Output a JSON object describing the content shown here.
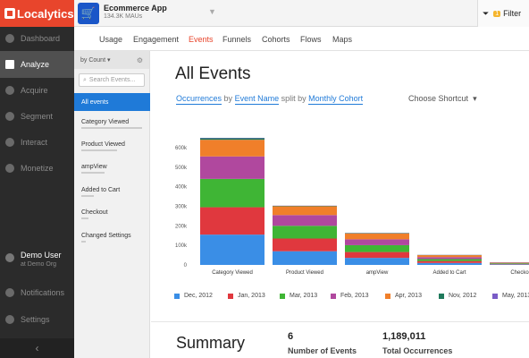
{
  "brand": {
    "name": "Localytics"
  },
  "nav": {
    "items": [
      {
        "label": "Dashboard",
        "icon": "dashboard-icon"
      },
      {
        "label": "Analyze",
        "icon": "analyze-icon",
        "active": true
      },
      {
        "label": "Acquire",
        "icon": "acquire-icon"
      },
      {
        "label": "Segment",
        "icon": "segment-icon"
      },
      {
        "label": "Interact",
        "icon": "interact-icon"
      },
      {
        "label": "Monetize",
        "icon": "monetize-icon"
      }
    ],
    "user": {
      "name": "Demo User",
      "org": "at Demo Org"
    },
    "notifications": "Notifications",
    "settings": "Settings",
    "collapse": "‹"
  },
  "topbar": {
    "app_name": "Ecommerce App",
    "app_maus": "134.3K MAUs",
    "filters_label": "Filter",
    "filters_count": "1"
  },
  "subnav": {
    "tabs": [
      "Usage",
      "Engagement",
      "Events",
      "Funnels",
      "Cohorts",
      "Flows",
      "Maps"
    ],
    "active": "Events"
  },
  "events_panel": {
    "sort_label": "by Count",
    "search_placeholder": "Search Events...",
    "items": [
      "All events",
      "Category Viewed",
      "Product Viewed",
      "ampView",
      "Added to Cart",
      "Checkout",
      "Changed Settings"
    ]
  },
  "main": {
    "title": "All Events",
    "controls": {
      "metric": "Occurrences",
      "by_word": "by",
      "dimension": "Event Name",
      "split_word": "split by",
      "split": "Monthly Cohort",
      "shortcut": "Choose Shortcut"
    },
    "summary": {
      "title": "Summary",
      "events_count": "6",
      "events_label": "Number of Events",
      "occurrences": "1,189,011",
      "occurrences_label": "Total Occurrences"
    }
  },
  "chart_data": {
    "type": "bar",
    "stacked": true,
    "categories": [
      "Category Viewed",
      "Product Viewed",
      "ampView",
      "Added to Cart",
      "Checkout"
    ],
    "ylim": [
      0,
      650000
    ],
    "yticks": [
      0,
      100000,
      200000,
      300000,
      400000,
      500000,
      600000
    ],
    "ytick_labels": [
      "0",
      "100k",
      "200k",
      "300k",
      "400k",
      "500k",
      "600k"
    ],
    "series": [
      {
        "name": "Dec, 2012",
        "color": "#3a8ee6",
        "values": [
          155000,
          70000,
          36000,
          10000,
          3000
        ]
      },
      {
        "name": "Jan, 2013",
        "color": "#e0383e",
        "values": [
          140000,
          65000,
          30000,
          10000,
          3000
        ]
      },
      {
        "name": "Mar, 2013",
        "color": "#3fb535",
        "values": [
          145000,
          65000,
          35000,
          10000,
          3000
        ]
      },
      {
        "name": "Feb, 2013",
        "color": "#b0489e",
        "values": [
          115000,
          55000,
          30000,
          10000,
          2000
        ]
      },
      {
        "name": "Apr, 2013",
        "color": "#f07f2a",
        "values": [
          85000,
          45000,
          30000,
          10000,
          2000
        ]
      },
      {
        "name": "Nov, 2012",
        "color": "#1f7a5c",
        "values": [
          8000,
          2000,
          2000,
          1000,
          500
        ]
      },
      {
        "name": "May, 2013",
        "color": "#7a5cc7",
        "values": [
          2000,
          1000,
          1000,
          500,
          200
        ]
      }
    ]
  }
}
